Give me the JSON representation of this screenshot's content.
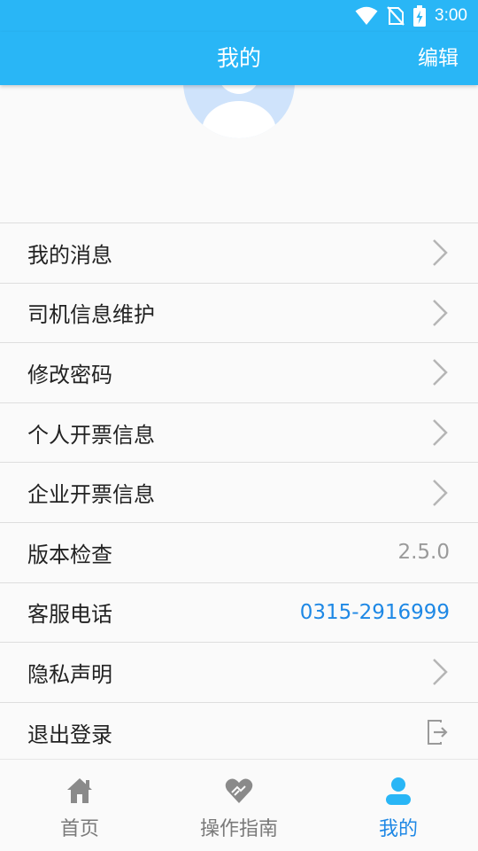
{
  "status_bar": {
    "time": "3:00"
  },
  "app_bar": {
    "title": "我的",
    "edit_label": "编辑"
  },
  "menu": {
    "items": [
      {
        "label": "我的消息"
      },
      {
        "label": "司机信息维护"
      },
      {
        "label": "修改密码"
      },
      {
        "label": "个人开票信息"
      },
      {
        "label": "企业开票信息"
      },
      {
        "label": "版本检查",
        "value": "2.5.0"
      },
      {
        "label": "客服电话",
        "value": "0315-2916999"
      },
      {
        "label": "隐私声明"
      },
      {
        "label": "退出登录"
      }
    ]
  },
  "tabs": [
    {
      "label": "首页",
      "icon": "home-icon"
    },
    {
      "label": "操作指南",
      "icon": "heart-hands-icon"
    },
    {
      "label": "我的",
      "icon": "person-icon",
      "active": true
    }
  ],
  "colors": {
    "primary": "#29b6f6",
    "accent": "#1e88e5",
    "tab_inactive_icon": "#8a8a8a",
    "avatar_bg": "#cfe3fb"
  }
}
